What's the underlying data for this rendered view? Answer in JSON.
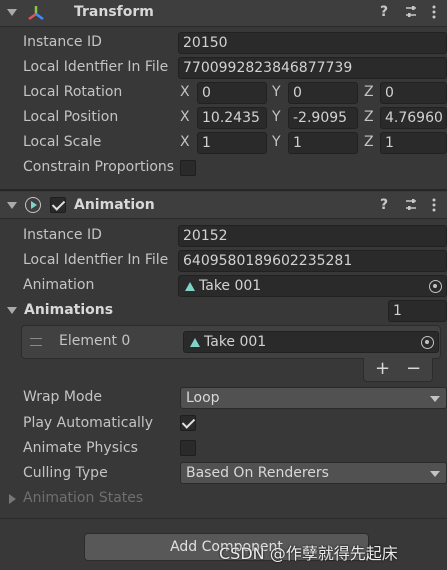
{
  "transform": {
    "title": "Transform",
    "instance_id_label": "Instance ID",
    "instance_id": "20150",
    "local_identifier_label": "Local Identfier In File",
    "local_identifier": "7700992823846877739",
    "rotation_label": "Local Rotation",
    "rotation": {
      "x": "0",
      "y": "0",
      "z": "0"
    },
    "position_label": "Local Position",
    "position": {
      "x": "10.2435",
      "y": "-2.9095",
      "z": "4.76960"
    },
    "scale_label": "Local Scale",
    "scale": {
      "x": "1",
      "y": "1",
      "z": "1"
    },
    "constrain_label": "Constrain Proportions",
    "constrain_checked": false
  },
  "axes": {
    "x": "X",
    "y": "Y",
    "z": "Z"
  },
  "animation": {
    "title": "Animation",
    "enabled": true,
    "instance_id_label": "Instance ID",
    "instance_id": "20152",
    "local_identifier_label": "Local Identfier In File",
    "local_identifier": "6409580189602235281",
    "animation_label": "Animation",
    "animation_value": "Take 001",
    "animations_label": "Animations",
    "animations_count": "1",
    "elements": [
      {
        "label": "Element 0",
        "value": "Take 001"
      }
    ],
    "add_symbol": "+",
    "remove_symbol": "−",
    "wrap_mode_label": "Wrap Mode",
    "wrap_mode": "Loop",
    "play_auto_label": "Play Automatically",
    "play_auto_checked": true,
    "animate_physics_label": "Animate Physics",
    "animate_physics_checked": false,
    "culling_label": "Culling Type",
    "culling_value": "Based On Renderers",
    "states_label": "Animation States"
  },
  "add_component_label": "Add Component",
  "watermark": "CSDN @作孽就得先起床",
  "icons": {
    "transform": "transform-axes-icon",
    "help": "help-icon",
    "presets": "presets-icon",
    "menu": "kebab-menu-icon",
    "animation": "animation-play-icon"
  },
  "colors": {
    "background": "#383838",
    "header": "#3e3e3e",
    "field": "#2a2a2a",
    "dropdown": "#515151",
    "accent_anim": "#7fd4c8"
  }
}
